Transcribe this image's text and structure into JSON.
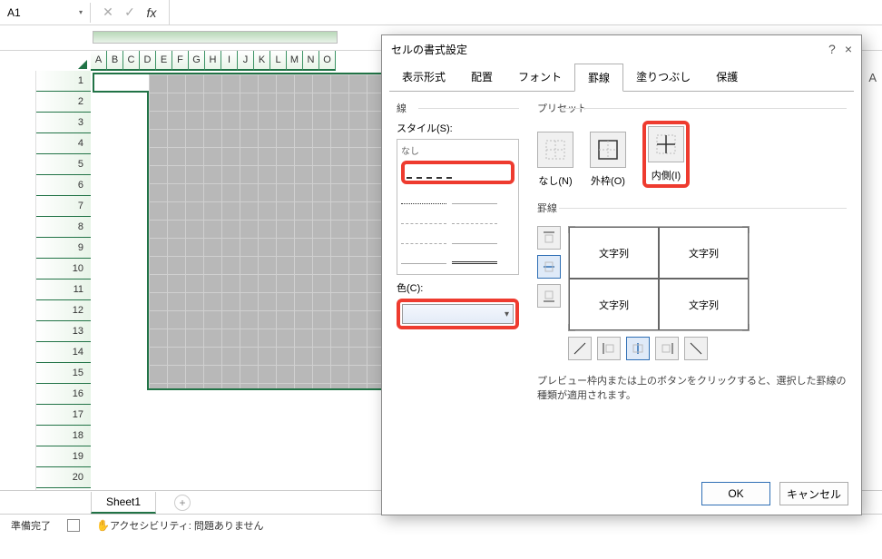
{
  "cell_ref": "A1",
  "formula_bar": {
    "fx": "fx",
    "value": ""
  },
  "columns": [
    "A",
    "B",
    "C",
    "D",
    "E",
    "F",
    "G",
    "H",
    "I",
    "J",
    "K",
    "L",
    "M",
    "N",
    "O"
  ],
  "rows": [
    "1",
    "2",
    "3",
    "4",
    "5",
    "6",
    "7",
    "8",
    "9",
    "10",
    "11",
    "12",
    "13",
    "14",
    "15",
    "16",
    "17",
    "18",
    "19",
    "20"
  ],
  "right_col_hint": "A",
  "sheet_tab": "Sheet1",
  "status": {
    "ready": "準備完了",
    "accessibility": "アクセシビリティ: 問題ありません"
  },
  "dialog": {
    "title": "セルの書式設定",
    "help_tip": "?",
    "close_tip": "×",
    "tabs": [
      "表示形式",
      "配置",
      "フォント",
      "罫線",
      "塗りつぶし",
      "保護"
    ],
    "active_tab": "罫線",
    "line_section": "線",
    "style_label": "スタイル(S):",
    "style_none": "なし",
    "color_label": "色(C):",
    "preset_section": "プリセット",
    "preset_labels": {
      "none": "なし(N)",
      "outline": "外枠(O)",
      "inside": "内側(I)"
    },
    "border_section": "罫線",
    "preview_text": "文字列",
    "hint": "プレビュー枠内または上のボタンをクリックすると、選択した罫線の種類が適用されます。",
    "ok": "OK",
    "cancel": "キャンセル"
  }
}
